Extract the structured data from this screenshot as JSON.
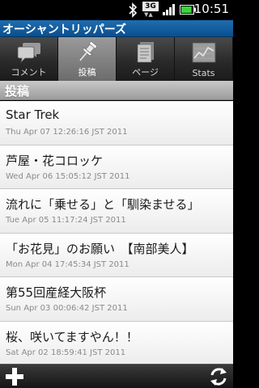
{
  "status_bar": {
    "network_label": "3G",
    "time": "10:51",
    "icons": [
      "bluetooth-icon",
      "network-3g-icon",
      "signal-icon",
      "battery-icon"
    ],
    "battery_level": 0.9
  },
  "app": {
    "title": "オーシャントリッパーズ"
  },
  "tabs": [
    {
      "label": "コメント",
      "icon": "comment-icon",
      "active": false
    },
    {
      "label": "投稿",
      "icon": "pushpin-icon",
      "active": true
    },
    {
      "label": "ページ",
      "icon": "pages-icon",
      "active": false
    },
    {
      "label": "Stats",
      "icon": "stats-icon",
      "active": false
    }
  ],
  "section": {
    "header": "投稿"
  },
  "posts": [
    {
      "title": "Star Trek",
      "date": "Thu Apr 07 12:26:16 JST 2011"
    },
    {
      "title": "芦屋・花コロッケ",
      "date": "Wed Apr 06 15:05:12 JST 2011"
    },
    {
      "title": "流れに「乗せる」と「馴染ませる」",
      "date": "Tue Apr 05 11:17:24 JST 2011"
    },
    {
      "title": "「お花見」のお願い　【南部美人】",
      "date": "Mon Apr 04 17:45:34 JST 2011"
    },
    {
      "title": "第55回産経大阪杯",
      "date": "Sun Apr 03 00:06:42 JST 2011"
    },
    {
      "title": "桜、咲いてますやん！！",
      "date": "Sat Apr 02 18:59:41 JST 2011"
    }
  ],
  "bottom_bar": {
    "icons": [
      "add-icon",
      "refresh-icon"
    ]
  },
  "colors": {
    "title_bar": "#0f5c9e",
    "active_tab": "#7d7d7d",
    "section_header": "#b2b2b2"
  }
}
